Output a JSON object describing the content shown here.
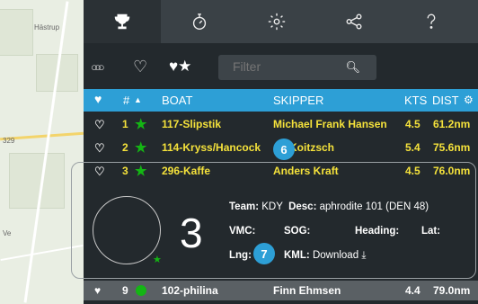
{
  "map": {
    "places": [
      "Hästrup",
      "329",
      "Ve"
    ]
  },
  "tabs": [
    {
      "icon": "trophy-icon"
    },
    {
      "icon": "stopwatch-icon"
    },
    {
      "icon": "settings-icon"
    },
    {
      "icon": "share-icon"
    },
    {
      "icon": "help-icon"
    }
  ],
  "toolbar": {
    "filter_placeholder": "Filter",
    "icons": [
      "rings-icon",
      "heart-icon",
      "heart-star-icon",
      "search-icon"
    ]
  },
  "table": {
    "headers": {
      "num": "#",
      "boat": "BOAT",
      "skipper": "SKIPPER",
      "kts": "KTS",
      "dist": "DIST"
    },
    "rows": [
      {
        "num": "1",
        "boat": "117-Slipstik",
        "skipper": "Michael Frank Hansen",
        "kts": "4.5",
        "dist": "61.2nm"
      },
      {
        "num": "2",
        "boat": "114-Kryss/Hancock",
        "skipper": "Koitzsch",
        "kts": "5.4",
        "dist": "75.6nm"
      },
      {
        "num": "3",
        "boat": "296-Kaffe",
        "skipper": "Anders Kraft",
        "kts": "4.5",
        "dist": "76.0nm"
      }
    ],
    "last_row": {
      "num": "9",
      "boat": "102-philina",
      "skipper": "Finn Ehmsen",
      "kts": "4.4",
      "dist": "79.0nm"
    }
  },
  "detail": {
    "big_number": "3",
    "team_label": "Team:",
    "team": "KDY",
    "desc_label": "Desc:",
    "desc": "aphrodite 101 (DEN 48)",
    "vmc_label": "VMC:",
    "sog_label": "SOG:",
    "heading_label": "Heading:",
    "lat_label": "Lat:",
    "lng_label": "Lng:",
    "kml_label": "KML:",
    "kml_link": "Download"
  },
  "badges": [
    "6",
    "7"
  ],
  "colors": {
    "accent": "#2d9fd6",
    "highlight": "#f5e23b",
    "star": "#14b514"
  }
}
